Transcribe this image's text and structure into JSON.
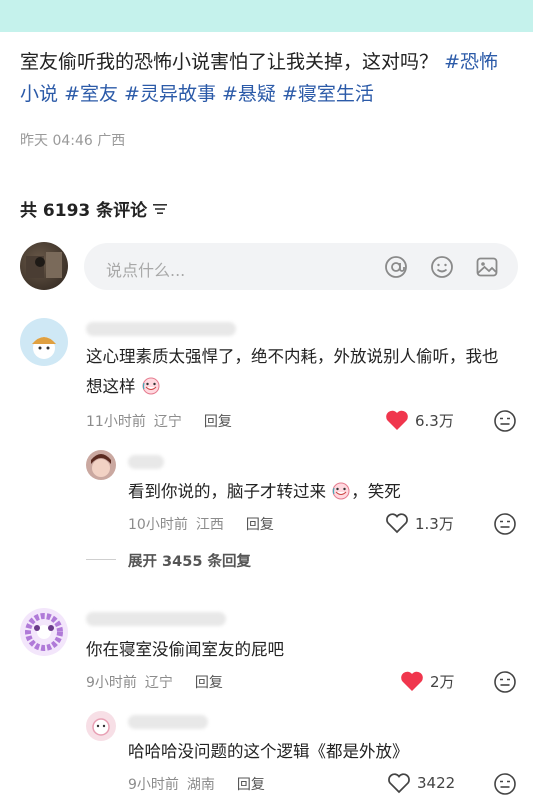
{
  "post": {
    "title": "室友偷听我的恐怖小说害怕了让我关掉，这对吗？",
    "tags": [
      "#恐怖小说",
      "#室友",
      "#灵异故事",
      "#悬疑",
      "#寝室生活"
    ],
    "meta": "昨天 04:46 广西"
  },
  "comments_header": {
    "count_label": "共 6193 条评论"
  },
  "input": {
    "placeholder": "说点什么..."
  },
  "comments": [
    {
      "text": "这心理素质太强悍了，绝不内耗，外放说别人偷听，我也想这样",
      "time": "11小时前",
      "location": "辽宁",
      "reply_label": "回复",
      "likes": "6.3万",
      "liked": true
    },
    {
      "text": "看到你说的，脑子才转过来",
      "text_after": "，笑死",
      "time": "10小时前",
      "location": "江西",
      "reply_label": "回复",
      "likes": "1.3万",
      "liked": false
    },
    {
      "text": "你在寝室没偷闻室友的屁吧",
      "time": "9小时前",
      "location": "辽宁",
      "reply_label": "回复",
      "likes": "2万",
      "liked": true
    },
    {
      "text": "哈哈哈没问题的这个逻辑《都是外放》",
      "time": "9小时前",
      "location": "湖南",
      "reply_label": "回复",
      "likes": "3422",
      "liked": false
    }
  ],
  "expand_replies": "展开 3455 条回复",
  "colors": {
    "like_red": "#f0364d",
    "tag_blue": "#2b5aa8",
    "topbar": "#c5f2ec"
  }
}
